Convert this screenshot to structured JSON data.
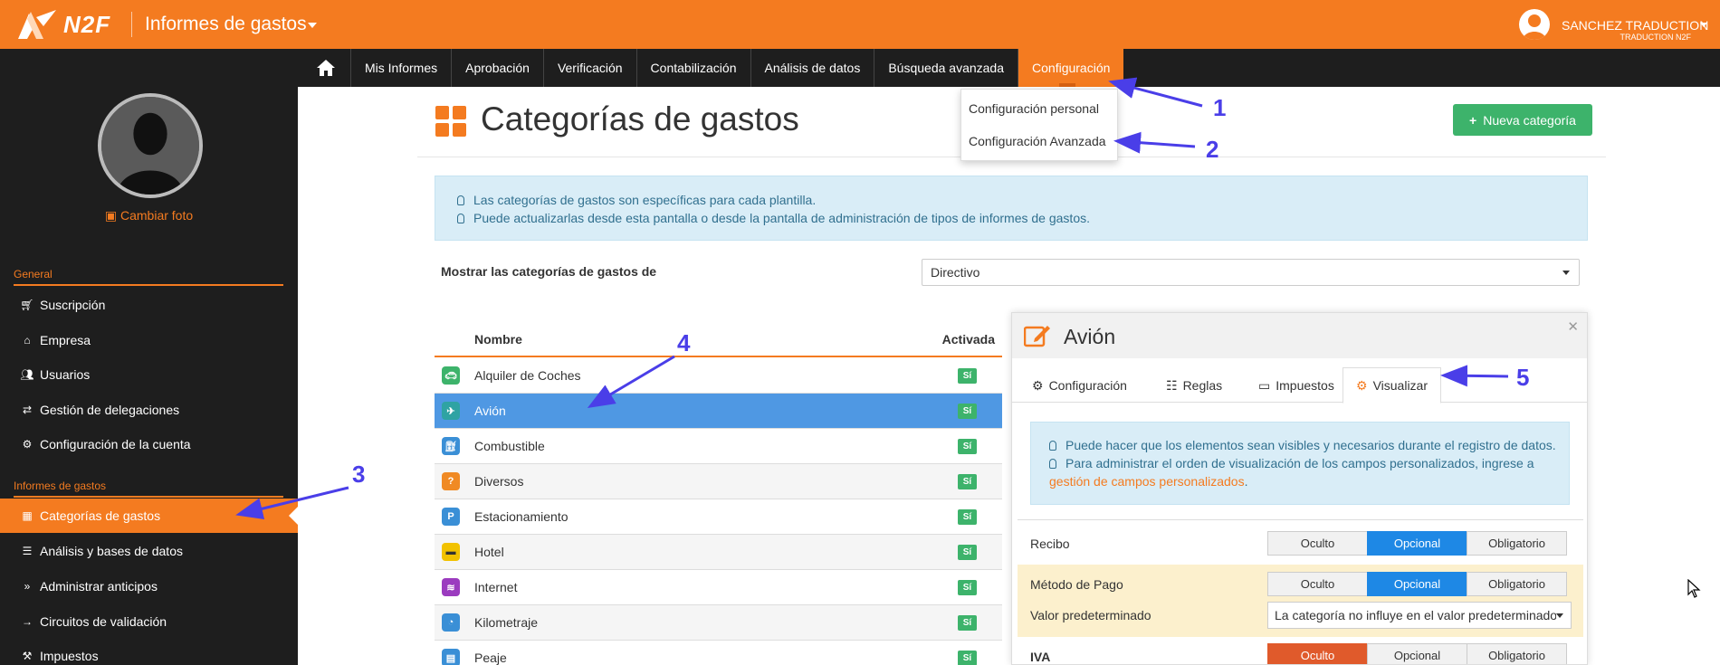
{
  "app": {
    "logo_text": "N2F",
    "title": "Informes de gastos",
    "user_name": "SANCHEZ TRADUCTION",
    "user_org": "TRADUCTION N2F"
  },
  "nav": {
    "items": [
      "Mis Informes",
      "Aprobación",
      "Verificación",
      "Contabilización",
      "Análisis de datos",
      "Búsqueda avanzada",
      "Configuración"
    ],
    "active": "Configuración"
  },
  "dropdown": {
    "items": [
      "Configuración personal",
      "Configuración Avanzada"
    ]
  },
  "sidebar": {
    "change_photo": "Cambiar foto",
    "section_general": "General",
    "general_items": [
      "Suscripción",
      "Empresa",
      "Usuarios",
      "Gestión de delegaciones",
      "Configuración de la cuenta"
    ],
    "section_expenses": "Informes de gastos",
    "expense_items": [
      "Categorías de gastos",
      "Análisis y bases de datos",
      "Administrar anticipos",
      "Circuitos de validación",
      "Impuestos"
    ]
  },
  "main": {
    "title": "Categorías de gastos",
    "new_button": "Nueva categoría",
    "info_lines": [
      "Las categorías de gastos son específicas para cada plantilla.",
      "Puede actualizarlas desde esta pantalla o desde la pantalla de administración de tipos de informes de gastos."
    ],
    "filter_label": "Mostrar las categorías de gastos de",
    "filter_value": "Directivo"
  },
  "category_table": {
    "col_name": "Nombre",
    "col_active": "Activada",
    "rows": [
      {
        "name": "Alquiler de Coches",
        "active": "Sí",
        "color": "#3db36b"
      },
      {
        "name": "Avión",
        "active": "Sí",
        "color": "#2fa3a3"
      },
      {
        "name": "Combustible",
        "active": "Sí",
        "color": "#3a8fd6"
      },
      {
        "name": "Diversos",
        "active": "Sí",
        "color": "#f08a24"
      },
      {
        "name": "Estacionamiento",
        "active": "Sí",
        "color": "#3a8fd6"
      },
      {
        "name": "Hotel",
        "active": "Sí",
        "color": "#f2c200"
      },
      {
        "name": "Internet",
        "active": "Sí",
        "color": "#9b3bbf"
      },
      {
        "name": "Kilometraje",
        "active": "Sí",
        "color": "#3a8fd6"
      },
      {
        "name": "Peaje",
        "active": "Sí",
        "color": "#3a8fd6"
      }
    ],
    "selected": "Avión"
  },
  "panel": {
    "title": "Avión",
    "tabs": [
      "Configuración",
      "Reglas",
      "Impuestos",
      "Visualizar"
    ],
    "active_tab": "Visualizar",
    "info_line1": "Puede hacer que los elementos sean visibles y necesarios durante el registro de datos.",
    "info_line2": "Para administrar el orden de visualización de los campos personalizados, ingrese a",
    "info_link": "gestión de campos personalizados",
    "options": [
      "Oculto",
      "Opcional",
      "Obligatorio"
    ],
    "rows": [
      {
        "label": "Recibo",
        "selected": "Opcional"
      },
      {
        "label": "Método de Pago",
        "selected": "Opcional"
      },
      {
        "label": "IVA",
        "selected": "Oculto"
      }
    ],
    "default_label": "Valor predeterminado",
    "default_value": "La categoría no influye en el valor predeterminado"
  },
  "annotations": [
    "1",
    "2",
    "3",
    "4",
    "5"
  ],
  "colors": {
    "brand_orange": "#f47b20",
    "nav_dark": "#1e1e1e",
    "selected_blue": "#4f98e3",
    "success_green": "#3db36b",
    "annotation_purple": "#4a3ee8"
  }
}
